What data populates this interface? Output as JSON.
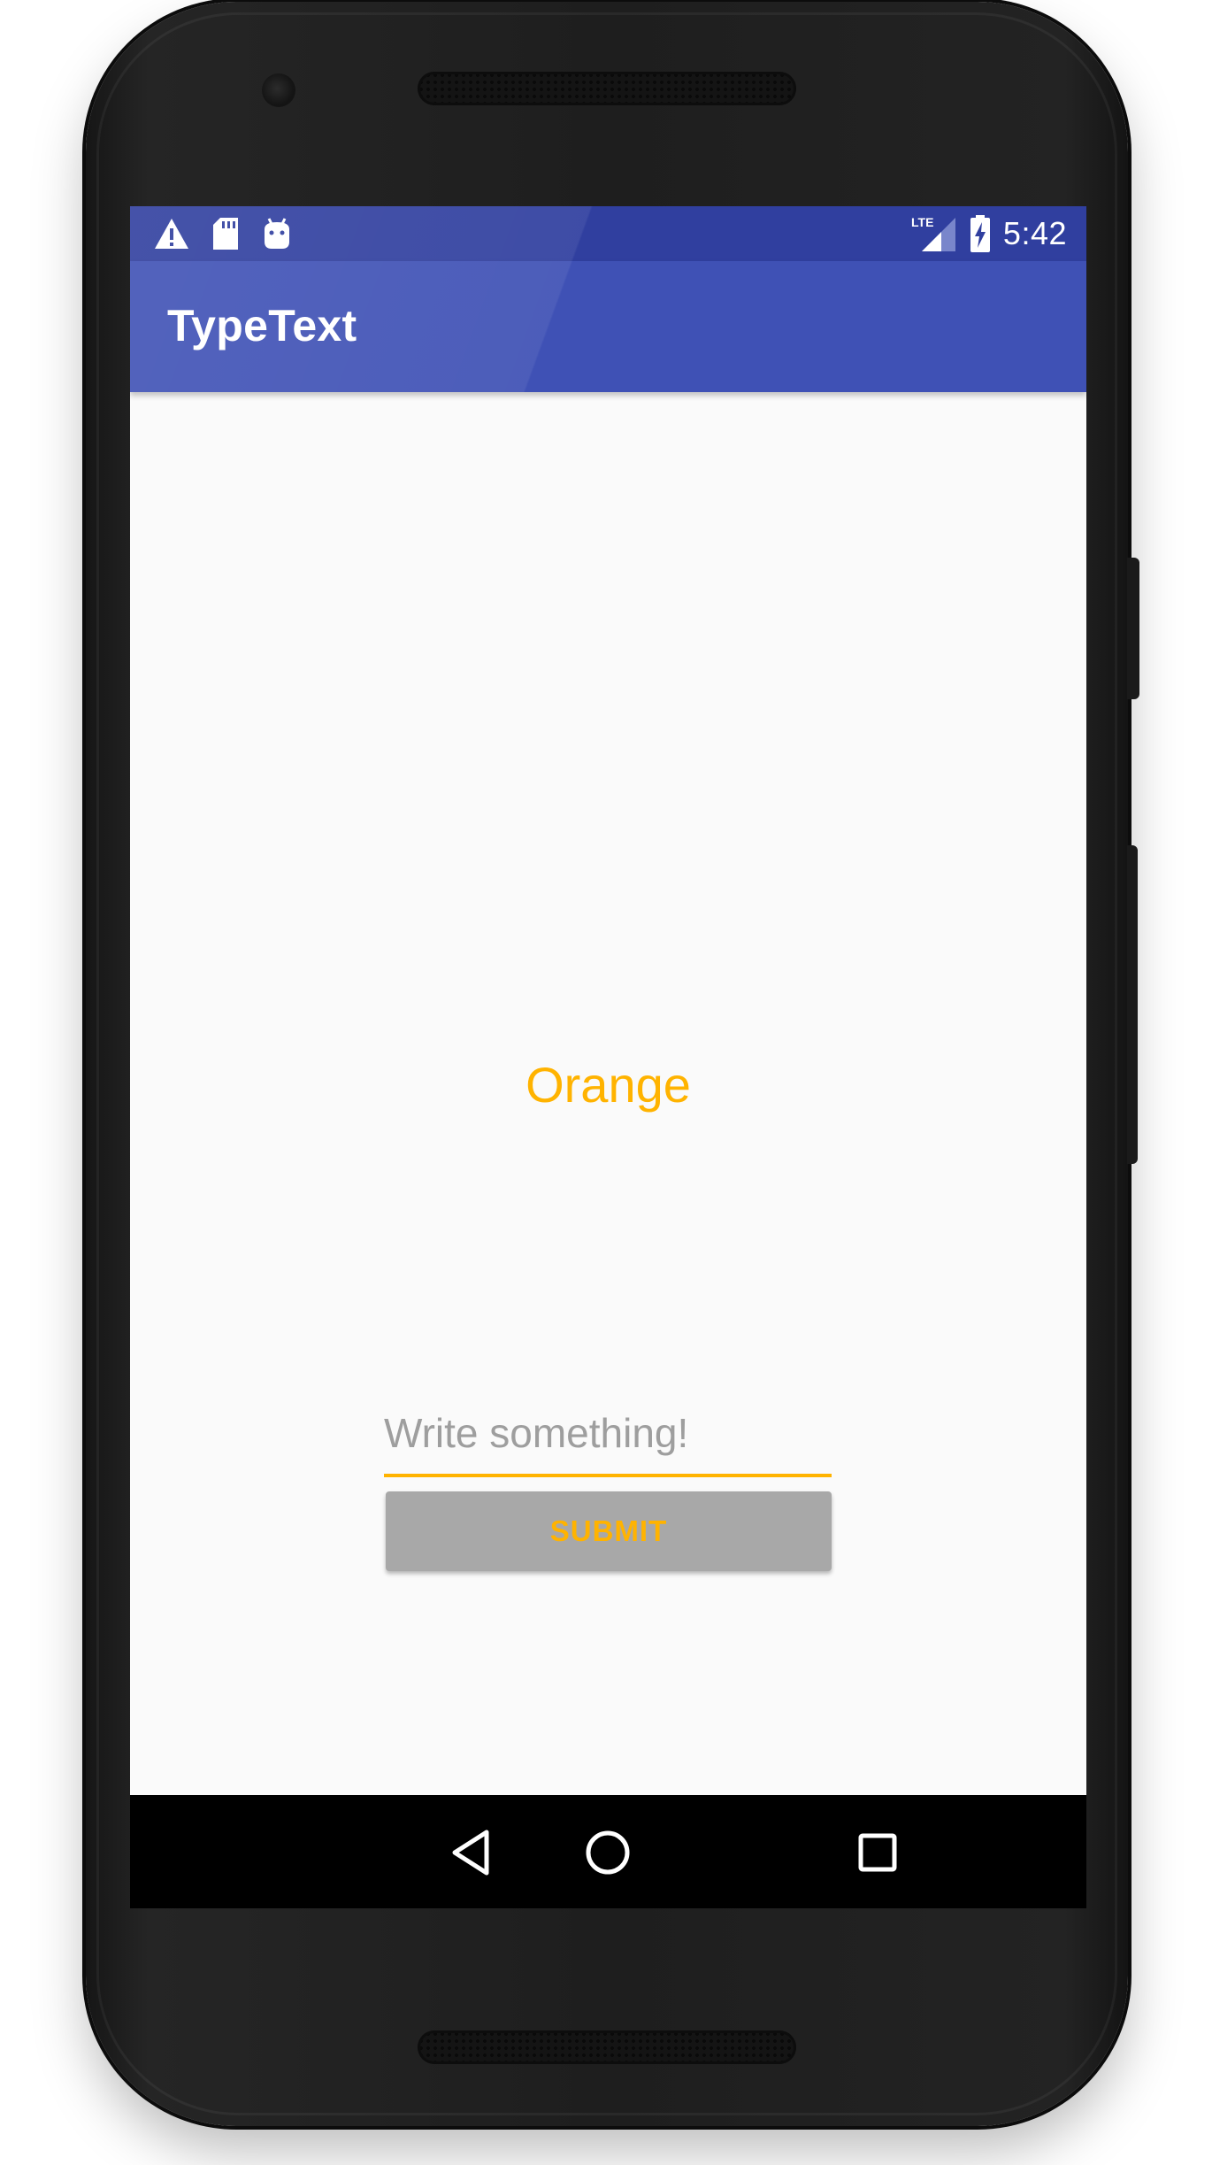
{
  "status_bar": {
    "time": "5:42",
    "network": "LTE",
    "left_icons": [
      "warning-icon",
      "sd-card-icon",
      "android-debug-icon"
    ],
    "right_icons": [
      "lte-signal-icon",
      "battery-charging-icon"
    ],
    "background_color": "#303f9f"
  },
  "app_bar": {
    "title": "TypeText",
    "background_color": "#3f51b5"
  },
  "main": {
    "display_text": "Orange",
    "input": {
      "value": "",
      "placeholder": "Write something!"
    },
    "submit_label": "SUBMIT",
    "accent_color": "#ffb300"
  },
  "nav_bar": {
    "buttons": [
      "back-icon",
      "home-icon",
      "recents-icon"
    ]
  }
}
